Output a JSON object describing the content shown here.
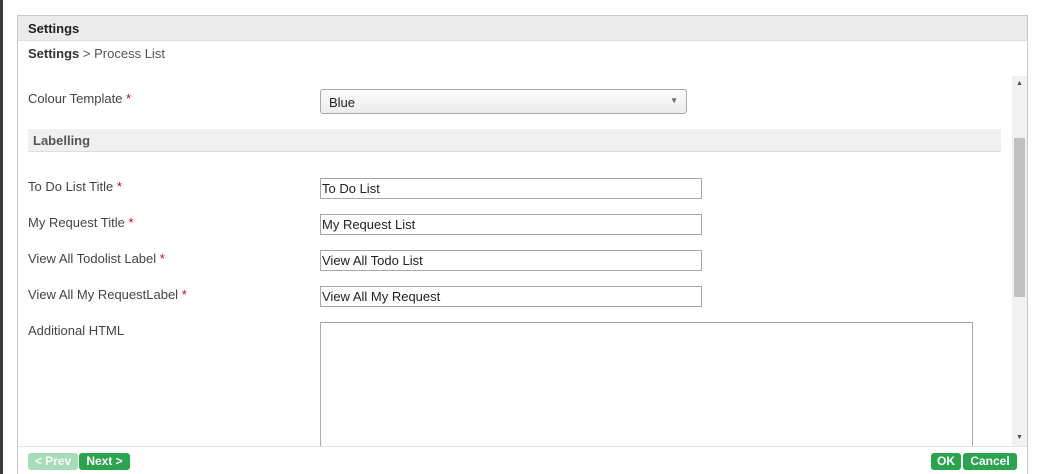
{
  "dialog": {
    "title": "Settings"
  },
  "breadcrumb": {
    "root": "Settings",
    "separator": " > ",
    "current": "Process List"
  },
  "form": {
    "colour_template": {
      "label": "Colour Template",
      "required_mark": "*",
      "value": "Blue"
    },
    "section_labelling": "Labelling",
    "todo_title": {
      "label": "To Do List Title",
      "required_mark": "*",
      "value": "To Do List"
    },
    "request_title": {
      "label": "My Request Title",
      "required_mark": "*",
      "value": "My Request List"
    },
    "view_all_todo": {
      "label": "View All Todolist Label",
      "required_mark": "*",
      "value": "View All Todo List"
    },
    "view_all_request": {
      "label": "View All My RequestLabel",
      "required_mark": "*",
      "value": "View All My Request"
    },
    "additional_html": {
      "label": "Additional HTML",
      "value": ""
    }
  },
  "footer": {
    "prev_label": "< Prev",
    "next_label": "Next >",
    "ok_label": "OK",
    "cancel_label": "Cancel"
  },
  "icons": {
    "select_arrow": "chevron-down-icon",
    "scroll_up": "scroll-up-arrow-icon",
    "scroll_down": "scroll-down-arrow-icon"
  },
  "colors": {
    "primary_button": "#2aa44f",
    "disabled_button": "#a8dbb9",
    "required_mark": "#d0021b",
    "header_bg": "#ebebeb"
  }
}
